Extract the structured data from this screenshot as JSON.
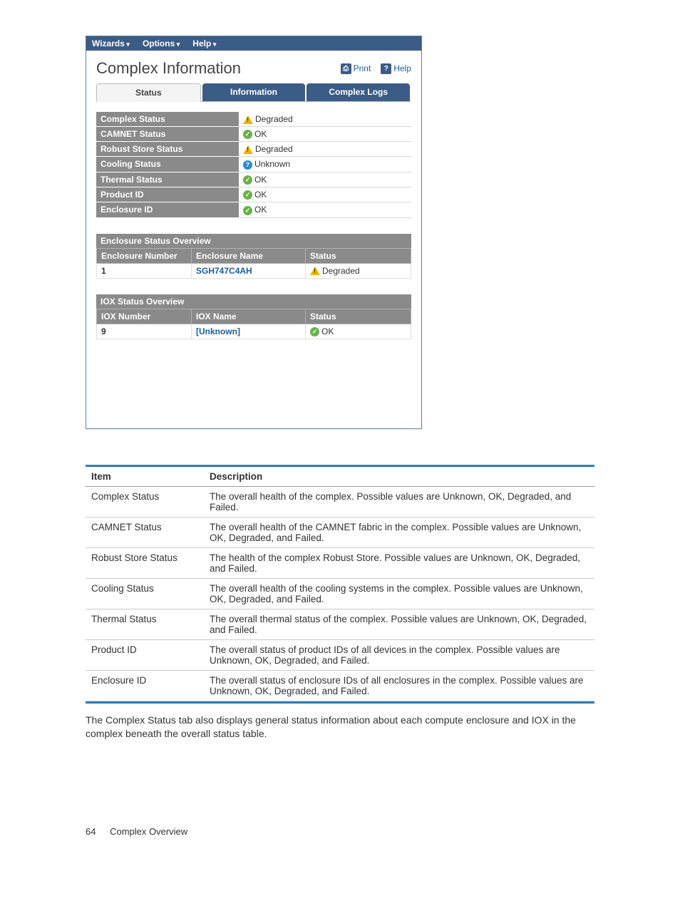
{
  "menubar": {
    "wizards": "Wizards",
    "options": "Options",
    "help": "Help"
  },
  "title": "Complex Information",
  "actions": {
    "print": "Print",
    "help": "Help"
  },
  "tabs": {
    "status": "Status",
    "information": "Information",
    "logs": "Complex Logs"
  },
  "statusRows": [
    {
      "label": "Complex Status",
      "icon": "warn",
      "text": "Degraded"
    },
    {
      "label": "CAMNET Status",
      "icon": "ok",
      "text": "OK"
    },
    {
      "label": "Robust Store Status",
      "icon": "warn",
      "text": "Degraded"
    },
    {
      "label": "Cooling Status",
      "icon": "unk",
      "text": "Unknown"
    },
    {
      "label": "Thermal Status",
      "icon": "ok",
      "text": "OK"
    },
    {
      "label": "Product ID",
      "icon": "ok",
      "text": "OK"
    },
    {
      "label": "Enclosure ID",
      "icon": "ok",
      "text": "OK"
    }
  ],
  "enclosure": {
    "heading": "Enclosure Status Overview",
    "cols": {
      "num": "Enclosure Number",
      "name": "Enclosure Name",
      "status": "Status"
    },
    "row": {
      "num": "1",
      "name": "SGH747C4AH",
      "icon": "warn",
      "status": "Degraded"
    }
  },
  "iox": {
    "heading": "IOX Status Overview",
    "cols": {
      "num": "IOX Number",
      "name": "IOX Name",
      "status": "Status"
    },
    "row": {
      "num": "9",
      "name": "[Unknown]",
      "icon": "ok",
      "status": "OK"
    }
  },
  "descHead": {
    "item": "Item",
    "desc": "Description"
  },
  "desc": [
    {
      "item": "Complex Status",
      "text": "The overall health of the complex. Possible values are Unknown, OK, Degraded, and Failed."
    },
    {
      "item": "CAMNET Status",
      "text": "The overall health of the CAMNET fabric in the complex. Possible values are Unknown, OK, Degraded, and Failed."
    },
    {
      "item": "Robust Store Status",
      "text": "The health of the complex Robust Store. Possible values are Unknown, OK, Degraded, and Failed."
    },
    {
      "item": "Cooling Status",
      "text": "The overall health of the cooling systems in the complex. Possible values are Unknown, OK, Degraded, and Failed."
    },
    {
      "item": "Thermal Status",
      "text": "The overall thermal status of the complex. Possible values are Unknown, OK, Degraded, and Failed."
    },
    {
      "item": "Product ID",
      "text": "The overall status of product IDs of all devices in the complex. Possible values are Unknown, OK, Degraded, and Failed."
    },
    {
      "item": "Enclosure ID",
      "text": "The overall status of enclosure IDs of all enclosures in the complex. Possible values are Unknown, OK, Degraded, and Failed."
    }
  ],
  "noteText": "The Complex Status tab also displays general status information about each compute enclosure and IOX in the complex beneath the overall status table.",
  "footer": {
    "page": "64",
    "section": "Complex Overview"
  }
}
